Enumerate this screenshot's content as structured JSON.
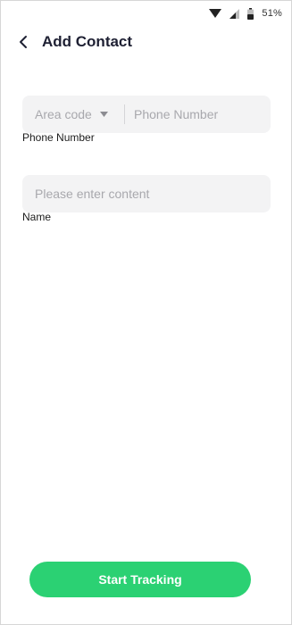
{
  "status_bar": {
    "battery_text": "51%",
    "icons": [
      "wifi-icon",
      "cell-signal-icon",
      "battery-icon"
    ]
  },
  "header": {
    "title": "Add Contact",
    "back_icon": "chevron-left-icon"
  },
  "phone": {
    "area_code_placeholder": "Area code",
    "number_placeholder": "Phone Number",
    "label": "Phone Number"
  },
  "name": {
    "placeholder": "Please enter content",
    "label": "Name"
  },
  "actions": {
    "start_label": "Start Tracking"
  },
  "colors": {
    "accent": "#2bd173",
    "field_bg": "#f3f3f4",
    "placeholder": "#a8a8ad",
    "title": "#1e2033"
  }
}
